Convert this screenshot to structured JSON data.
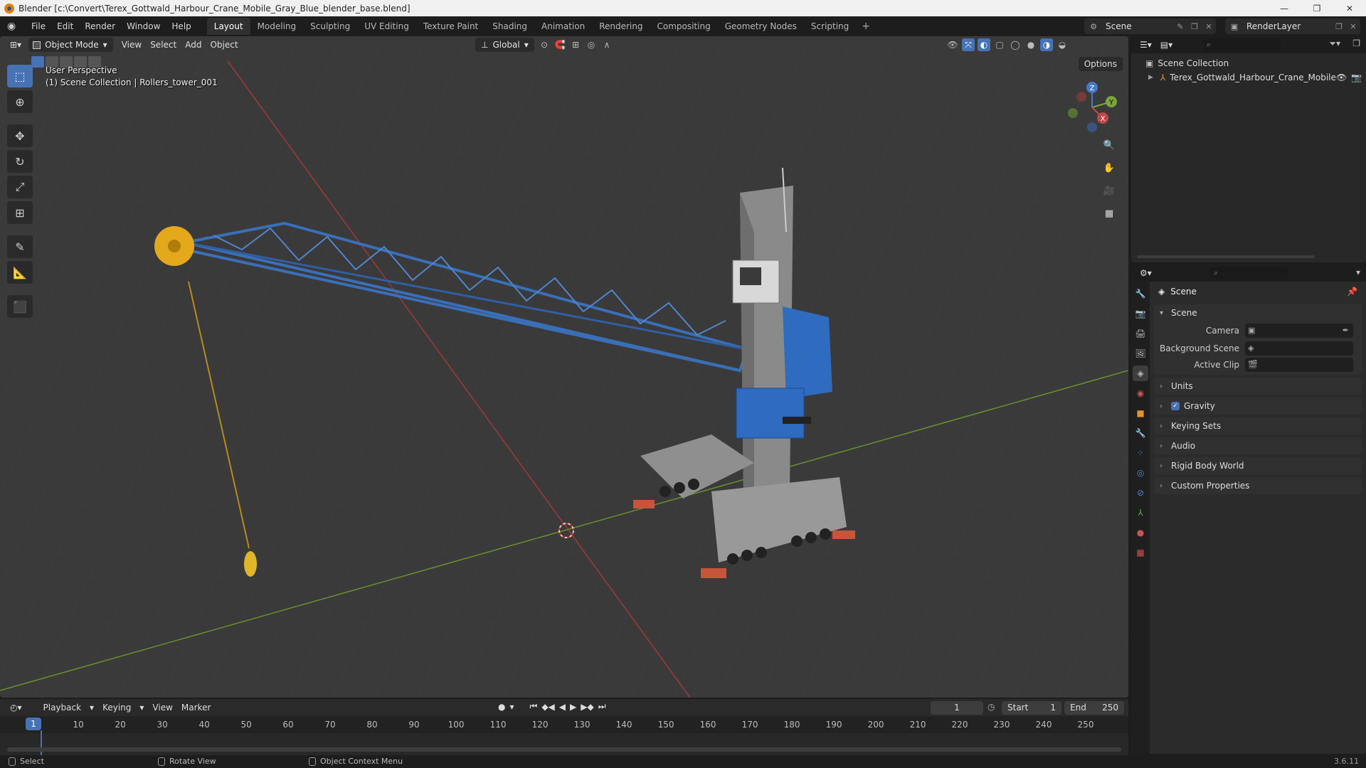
{
  "window": {
    "title": "Blender [c:\\Convert\\Terex_Gottwald_Harbour_Crane_Mobile_Gray_Blue_blender_base.blend]",
    "controls": [
      "—",
      "❐",
      "✕"
    ]
  },
  "menu": [
    "File",
    "Edit",
    "Render",
    "Window",
    "Help"
  ],
  "workspaces": {
    "active": "Layout",
    "tabs": [
      "Layout",
      "Modeling",
      "Sculpting",
      "UV Editing",
      "Texture Paint",
      "Shading",
      "Animation",
      "Rendering",
      "Compositing",
      "Geometry Nodes",
      "Scripting"
    ],
    "add": "+"
  },
  "scene_selector": "Scene",
  "render_layer": "RenderLayer",
  "viewport": {
    "mode": "Object Mode",
    "menu": [
      "View",
      "Select",
      "Add",
      "Object"
    ],
    "transform_orientation": "Global",
    "options_label": "Options",
    "info_line1": "User Perspective",
    "info_line2": "(1) Scene Collection | Rollers_tower_001",
    "gizmo": {
      "x": "X",
      "y": "Y",
      "z": "Z"
    }
  },
  "timeline": {
    "menu": [
      "Playback",
      "Keying",
      "View",
      "Marker"
    ],
    "current_frame": "1",
    "start_label": "Start",
    "start": "1",
    "end_label": "End",
    "end": "250",
    "ticks": [
      "10",
      "20",
      "30",
      "40",
      "50",
      "60",
      "70",
      "80",
      "90",
      "100",
      "110",
      "120",
      "130",
      "140",
      "150",
      "160",
      "170",
      "180",
      "190",
      "200",
      "210",
      "220",
      "230",
      "240",
      "250"
    ]
  },
  "outliner": {
    "root": "Scene Collection",
    "items": [
      "Terex_Gottwald_Harbour_Crane_Mobile"
    ]
  },
  "properties": {
    "context": "Scene",
    "panel_title": "Scene",
    "fields": [
      {
        "label": "Camera"
      },
      {
        "label": "Background Scene"
      },
      {
        "label": "Active Clip"
      }
    ],
    "sections": [
      "Units",
      "Gravity",
      "Keying Sets",
      "Audio",
      "Rigid Body World",
      "Custom Properties"
    ],
    "gravity_enabled": true
  },
  "status": {
    "select": "Select",
    "rotate": "Rotate View",
    "context_menu": "Object Context Menu",
    "version": "3.6.11"
  },
  "colors": {
    "accent": "#4772b3",
    "crane_blue": "#3a6fb8",
    "x_axis": "#b03a3a",
    "y_axis": "#7aa53a"
  }
}
